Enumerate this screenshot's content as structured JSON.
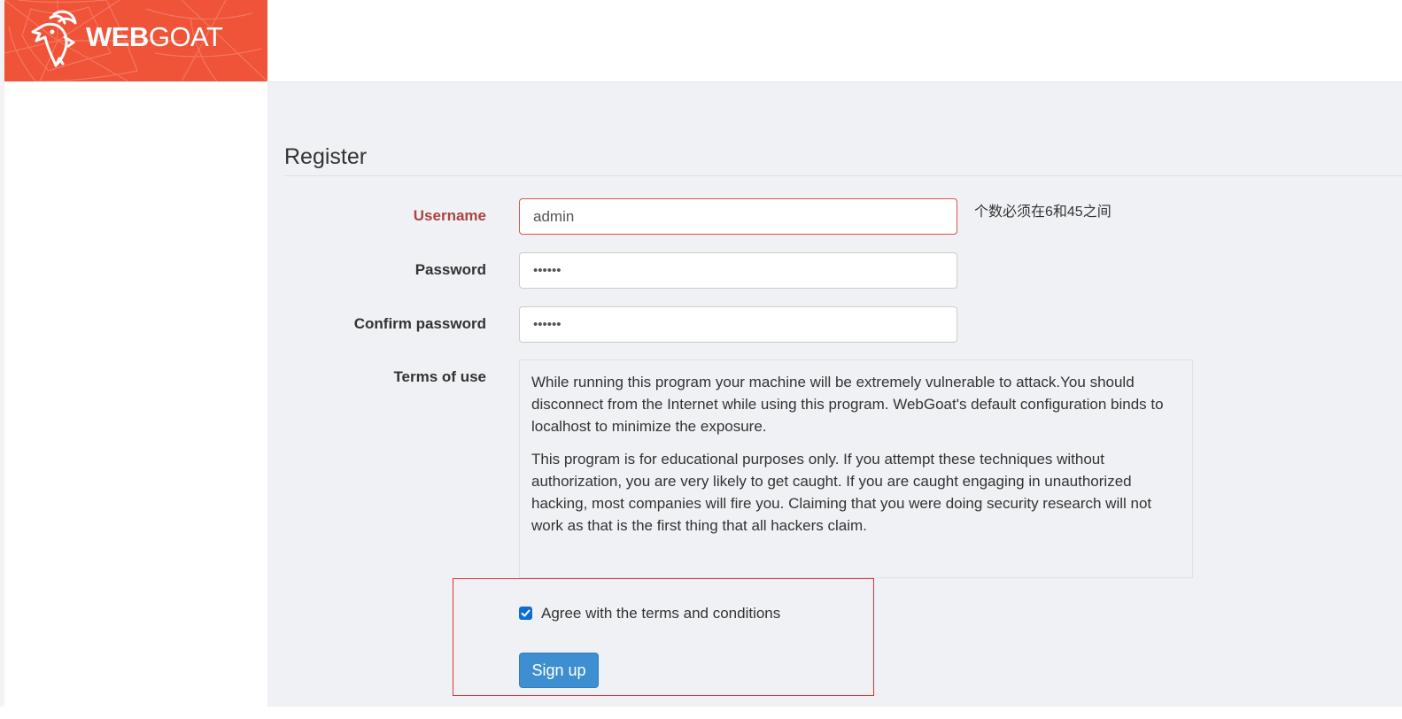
{
  "brand": {
    "logo_bold": "WEB",
    "logo_light": "GOAT",
    "colors": {
      "background": "#ef5338",
      "text": "#ffffff"
    }
  },
  "page": {
    "title": "Register"
  },
  "form": {
    "username": {
      "label": "Username",
      "value": "admin",
      "state": "error"
    },
    "username_hint": "个数必须在6和45之间",
    "password": {
      "label": "Password",
      "masked_value": "••••••"
    },
    "confirm_password": {
      "label": "Confirm password",
      "masked_value": "••••••"
    },
    "terms": {
      "label": "Terms of use",
      "paragraph1": "While running this program your machine will be extremely vulnerable to attack.You should disconnect from the Internet while using this program. WebGoat's default configuration binds to localhost to minimize the exposure.",
      "paragraph2": "This program is for educational purposes only. If you attempt these techniques without authorization, you are very likely to get caught. If you are caught engaging in unauthorized hacking, most companies will fire you. Claiming that you were doing security research will not work as that is the first thing that all hackers claim."
    },
    "agree": {
      "label": "Agree with the terms and conditions",
      "checked": true
    },
    "submit_label": "Sign up"
  },
  "colors": {
    "accent_button": "#3d8fd1",
    "error": "#a94442",
    "annotation_box": "#e0303a",
    "main_background": "#f0f1f5"
  },
  "icons": {
    "logo": "goat-head-icon",
    "checkbox": "checkmark-icon"
  }
}
